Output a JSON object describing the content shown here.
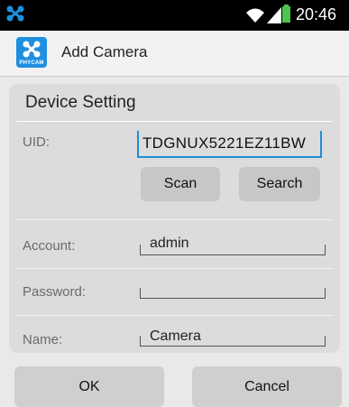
{
  "status_bar": {
    "time": "20:46",
    "icons": [
      "app-notification-icon",
      "wifi-icon",
      "signal-icon",
      "battery-icon"
    ],
    "battery_color": "#4ec34e"
  },
  "action_bar": {
    "title": "Add Camera",
    "logo_text": "PHYCAM",
    "logo_color": "#1e8fe0"
  },
  "device_setting": {
    "title": "Device Setting",
    "uid": {
      "label": "UID:",
      "value": "TDGNUX5221EZ11BW"
    },
    "scan_label": "Scan",
    "search_label": "Search",
    "account": {
      "label": "Account:",
      "value": "admin"
    },
    "password": {
      "label": "Password:",
      "value": ""
    },
    "name": {
      "label": "Name:",
      "value": "Camera"
    }
  },
  "footer": {
    "ok_label": "OK",
    "cancel_label": "Cancel"
  },
  "colors": {
    "accent": "#1c8fd6",
    "panel": "#dcdcdc",
    "button": "#c7c7c7"
  }
}
